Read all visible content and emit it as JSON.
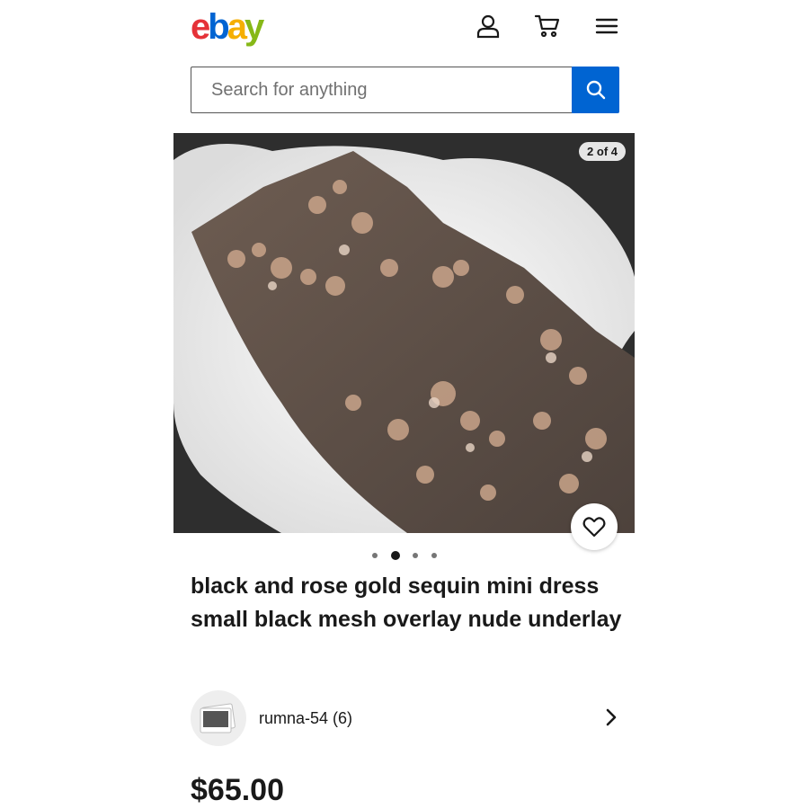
{
  "header": {
    "logo_letters": [
      "e",
      "b",
      "a",
      "y"
    ],
    "logo_colors": [
      "#e53238",
      "#0064d2",
      "#f5af02",
      "#86b817"
    ],
    "icons": [
      "account-icon",
      "cart-icon",
      "menu-icon"
    ]
  },
  "search": {
    "placeholder": "Search for anything",
    "button_icon": "search-icon",
    "button_color": "#0064d2"
  },
  "gallery": {
    "counter": "2 of 4",
    "total_images": 4,
    "active_index": 2,
    "favorite_icon": "heart-icon"
  },
  "listing": {
    "title": "black and rose gold sequin mini dress small black mesh overlay nude underlay",
    "price": "$65.00"
  },
  "seller": {
    "name_with_feedback": "rumna-54 (6)",
    "chevron_icon": "chevron-right-icon"
  }
}
